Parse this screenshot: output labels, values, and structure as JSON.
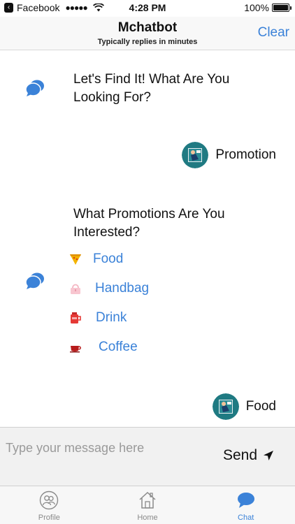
{
  "status_bar": {
    "back_app": "Facebook",
    "signal": "●●●●●",
    "time": "4:28 PM",
    "battery": "100%",
    "battery_level": 1.0
  },
  "nav": {
    "title": "Mchatbot",
    "subtitle": "Typically replies in minutes",
    "clear_label": "Clear"
  },
  "chat": {
    "bot_message_1": "Let's Find It! What Are You Looking For?",
    "user_reply_1": "Promotion",
    "bot_message_2": "What Promotions Are You Interested?",
    "options": [
      {
        "label": "Food",
        "icon": "pizza-icon"
      },
      {
        "label": "Handbag",
        "icon": "handbag-icon"
      },
      {
        "label": "Drink",
        "icon": "drink-icon"
      },
      {
        "label": "Coffee",
        "icon": "coffee-icon"
      }
    ],
    "user_reply_2": "Food"
  },
  "input": {
    "placeholder": "Type your message here",
    "value": "",
    "send_label": "Send"
  },
  "tabs": [
    {
      "label": "Profile",
      "icon": "profile-icon",
      "active": false
    },
    {
      "label": "Home",
      "icon": "home-icon",
      "active": false
    },
    {
      "label": "Chat",
      "icon": "chat-icon",
      "active": true
    }
  ],
  "colors": {
    "accent": "#3b82d8",
    "bot_icon": "#3b82d8",
    "tab_inactive": "#8a8a8a"
  }
}
